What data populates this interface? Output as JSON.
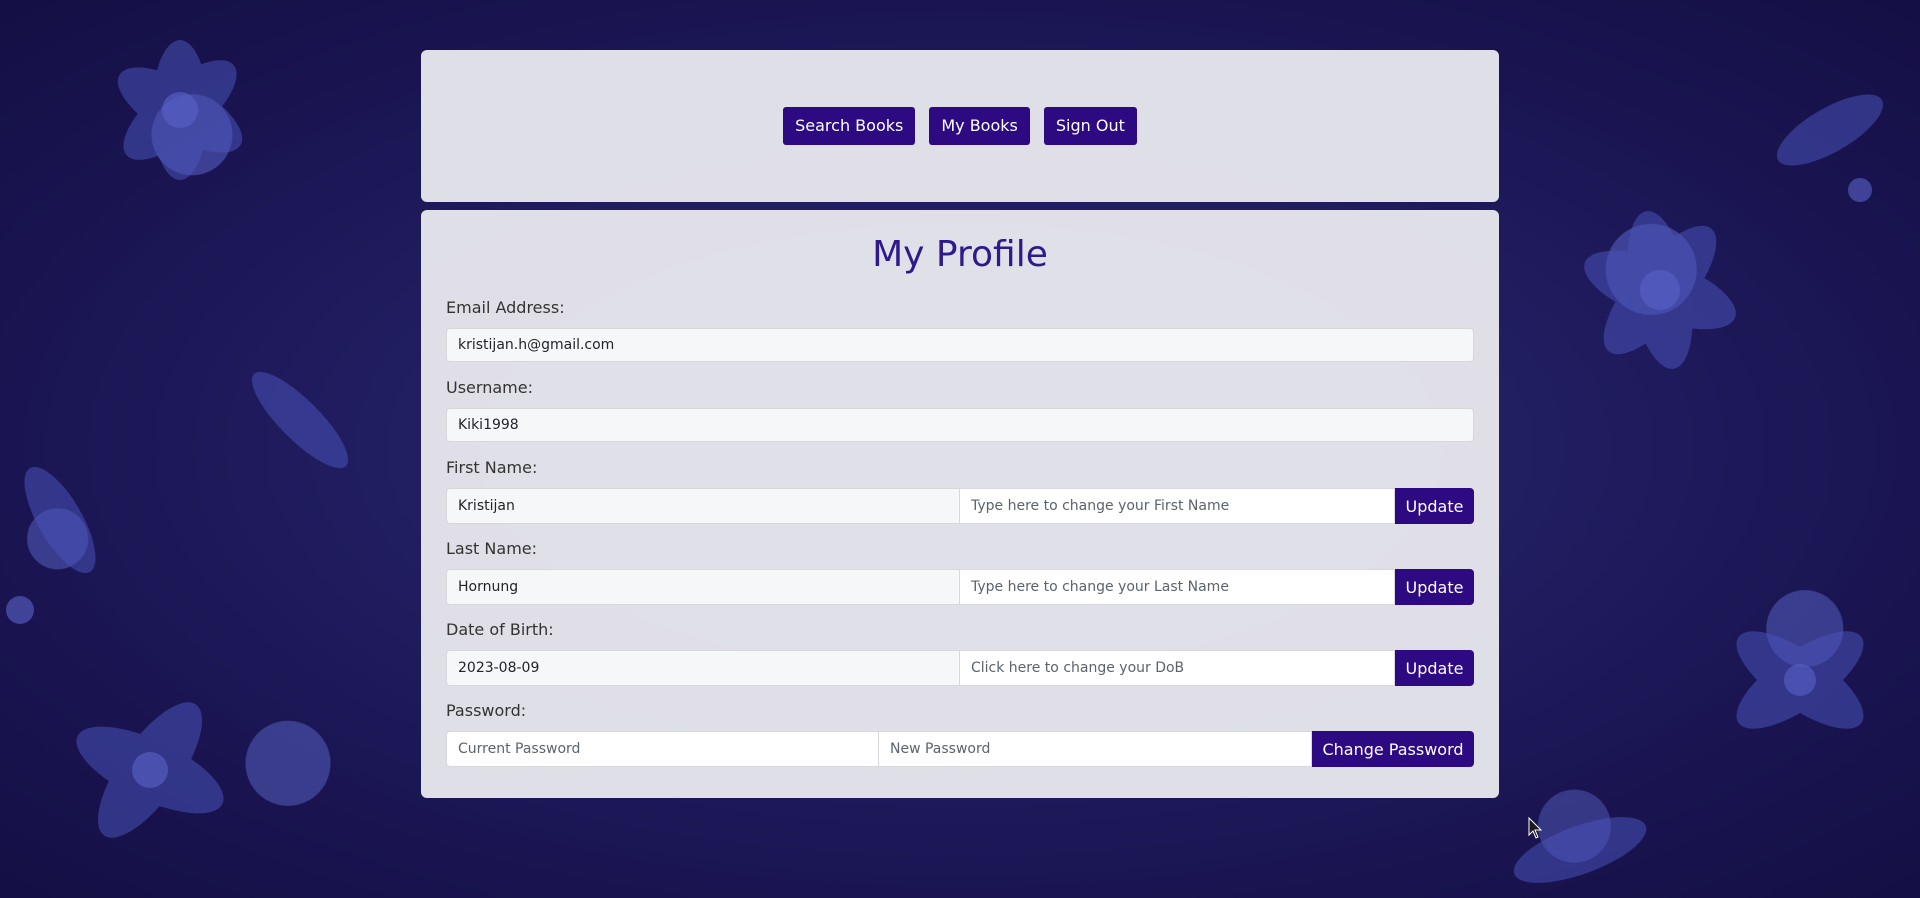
{
  "nav": {
    "search_books": "Search Books",
    "my_books": "My Books",
    "sign_out": "Sign Out"
  },
  "profile": {
    "title": "My Profile",
    "email": {
      "label": "Email Address:",
      "value": "kristijan.h@gmail.com"
    },
    "username": {
      "label": "Username:",
      "value": "Kiki1998"
    },
    "first_name": {
      "label": "First Name:",
      "value": "Kristijan",
      "placeholder": "Type here to change your First Name",
      "button": "Update"
    },
    "last_name": {
      "label": "Last Name:",
      "value": "Hornung",
      "placeholder": "Type here to change your Last Name",
      "button": "Update"
    },
    "dob": {
      "label": "Date of Birth:",
      "value": "2023-08-09",
      "placeholder": "Click here to change your DoB",
      "button": "Update"
    },
    "password": {
      "label": "Password:",
      "current_placeholder": "Current Password",
      "new_placeholder": "New Password",
      "button": "Change Password"
    }
  },
  "colors": {
    "accent": "#2e0a82",
    "title": "#2e1a8c",
    "background": "#1d1a5c"
  }
}
